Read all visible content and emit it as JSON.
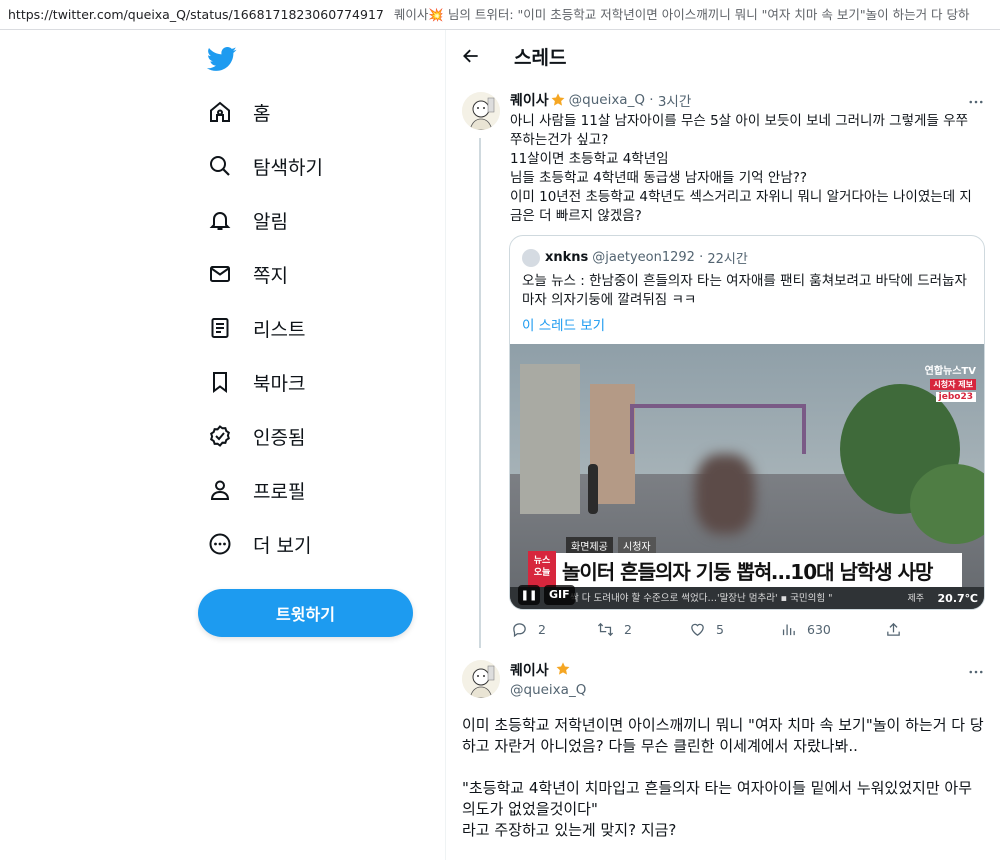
{
  "browser": {
    "url": "https://twitter.com/queixa_Q/status/1668171823060774917",
    "page_title": "퀘이사💥 님의 트위터: \"이미 초등학교 저학년이면 아이스깨끼니 뭐니 \"여자 치마 속 보기\"놀이 하는거 다 당하"
  },
  "sidebar": {
    "items": [
      {
        "label": "홈",
        "icon": "home-icon"
      },
      {
        "label": "탐색하기",
        "icon": "search-icon"
      },
      {
        "label": "알림",
        "icon": "bell-icon"
      },
      {
        "label": "쪽지",
        "icon": "mail-icon"
      },
      {
        "label": "리스트",
        "icon": "list-icon"
      },
      {
        "label": "북마크",
        "icon": "bookmark-icon"
      },
      {
        "label": "인증됨",
        "icon": "verified-icon"
      },
      {
        "label": "프로필",
        "icon": "person-icon"
      },
      {
        "label": "더 보기",
        "icon": "more-circle-icon"
      }
    ],
    "tweet_button": "트윗하기"
  },
  "header": {
    "title": "스레드"
  },
  "tweet1": {
    "name": "퀘이사",
    "handle": "@queixa_Q",
    "time": "3시간",
    "text": "아니 사람들 11살 남자아이를 무슨 5살 아이 보듯이 보네 그러니까 그렇게들 우쭈쭈하는건가 싶고?\n11살이면 초등학교 4학년임\n님들 초등학교 4학년때 동급생 남자애들 기억 안남??\n이미 10년전 초등학교 4학년도 섹스거리고 자위니 뭐니 알거다아는 나이였는데 지금은 더 빠르지 않겠음?",
    "quote": {
      "name": "xnkns",
      "handle": "@jaetyeon1292",
      "time": "22시간",
      "text": "오늘 뉴스 : 한남중이 흔들의자 타는 여자애를 팬티 훔쳐보려고 바닥에 드러눕자마자 의자기둥에 깔려뒤짐 ㅋㅋ",
      "link": "이 스레드 보기",
      "video": {
        "channel": "연합뉴스TV",
        "sub": "시청자 제보",
        "jebo": "jebo23",
        "credit": "화면제공",
        "credit2": "시청자",
        "badge": "뉴스\n오늘",
        "headline": "놀이터 흔들의자 기둥 뽑혀…10대 남학생 사망",
        "ticker": "싹 다 도려내야 할 수준으로 썩었다…'말장난 멈추라'  ▪ 국민의힘 \"",
        "place": "제주",
        "temp": "20.7℃",
        "gif_label": "GIF",
        "pause_label": "❚❚"
      }
    },
    "actions": {
      "replies": "2",
      "retweets": "2",
      "likes": "5",
      "views": "630"
    }
  },
  "tweet2": {
    "name": "퀘이사",
    "handle": "@queixa_Q",
    "text": "이미 초등학교 저학년이면 아이스깨끼니 뭐니 \"여자 치마 속 보기\"놀이 하는거 다 당하고 자란거 아니었음? 다들 무슨 클린한 이세계에서 자랐나봐..\n\n\"초등학교 4학년이 치마입고 흔들의자 타는 여자아이들 밑에서 누워있었지만 아무 의도가 없었을것이다\"\n라고 주장하고 있는게 맞지? 지금?"
  },
  "colors": {
    "accent": "#1d9bf0",
    "text": "#0f1419",
    "muted": "#536471",
    "border": "#cfd9de"
  }
}
